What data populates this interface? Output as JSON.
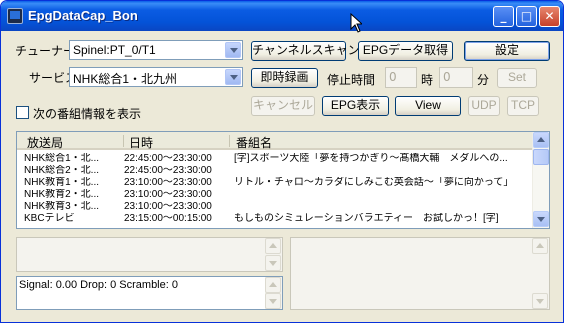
{
  "window": {
    "title": "EpgDataCap_Bon"
  },
  "tuner": {
    "label": "チューナー",
    "value": "Spinel:PT_0/T1"
  },
  "service": {
    "label": "サービス",
    "value": "NHK総合1・北九州"
  },
  "buttons": {
    "channel_scan": "チャンネルスキャン",
    "epg_get": "EPGデータ取得",
    "settings": "設定",
    "instant_record": "即時録画",
    "cancel": "キャンセル",
    "epg_show": "EPG表示",
    "view": "View",
    "udp": "UDP",
    "tcp": "TCP",
    "set": "Set"
  },
  "stop_time": {
    "label": "停止時間",
    "hour_unit": "時",
    "minute_unit": "分",
    "hour_value": "0",
    "minute_value": "0"
  },
  "next_program_checkbox": {
    "label": "次の番組情報を表示",
    "checked": false
  },
  "program_list": {
    "columns": [
      "放送局",
      "日時",
      "番組名"
    ],
    "rows": [
      {
        "station": "NHK総合1・北...",
        "time": "22:45:00〜23:30:00",
        "title": "[字]スポーツ大陸「夢を持つかぎり〜髙橋大輔　メダルへの..."
      },
      {
        "station": "NHK総合2・北...",
        "time": "22:45:00〜23:30:00",
        "title": ""
      },
      {
        "station": "NHK教育1・北...",
        "time": "23:10:00〜23:30:00",
        "title": "リトル・チャロ〜カラダにしみこむ英会話〜「夢に向かって」"
      },
      {
        "station": "NHK教育2・北...",
        "time": "23:10:00〜23:30:00",
        "title": ""
      },
      {
        "station": "NHK教育3・北...",
        "time": "23:10:00〜23:30:00",
        "title": ""
      },
      {
        "station": "KBCテレビ",
        "time": "23:15:00〜00:15:00",
        "title": "もしものシミュレーションバラエティー　お試しかっ！[字]"
      }
    ]
  },
  "status": {
    "text": "Signal: 0.00 Drop: 0 Scramble: 0"
  }
}
